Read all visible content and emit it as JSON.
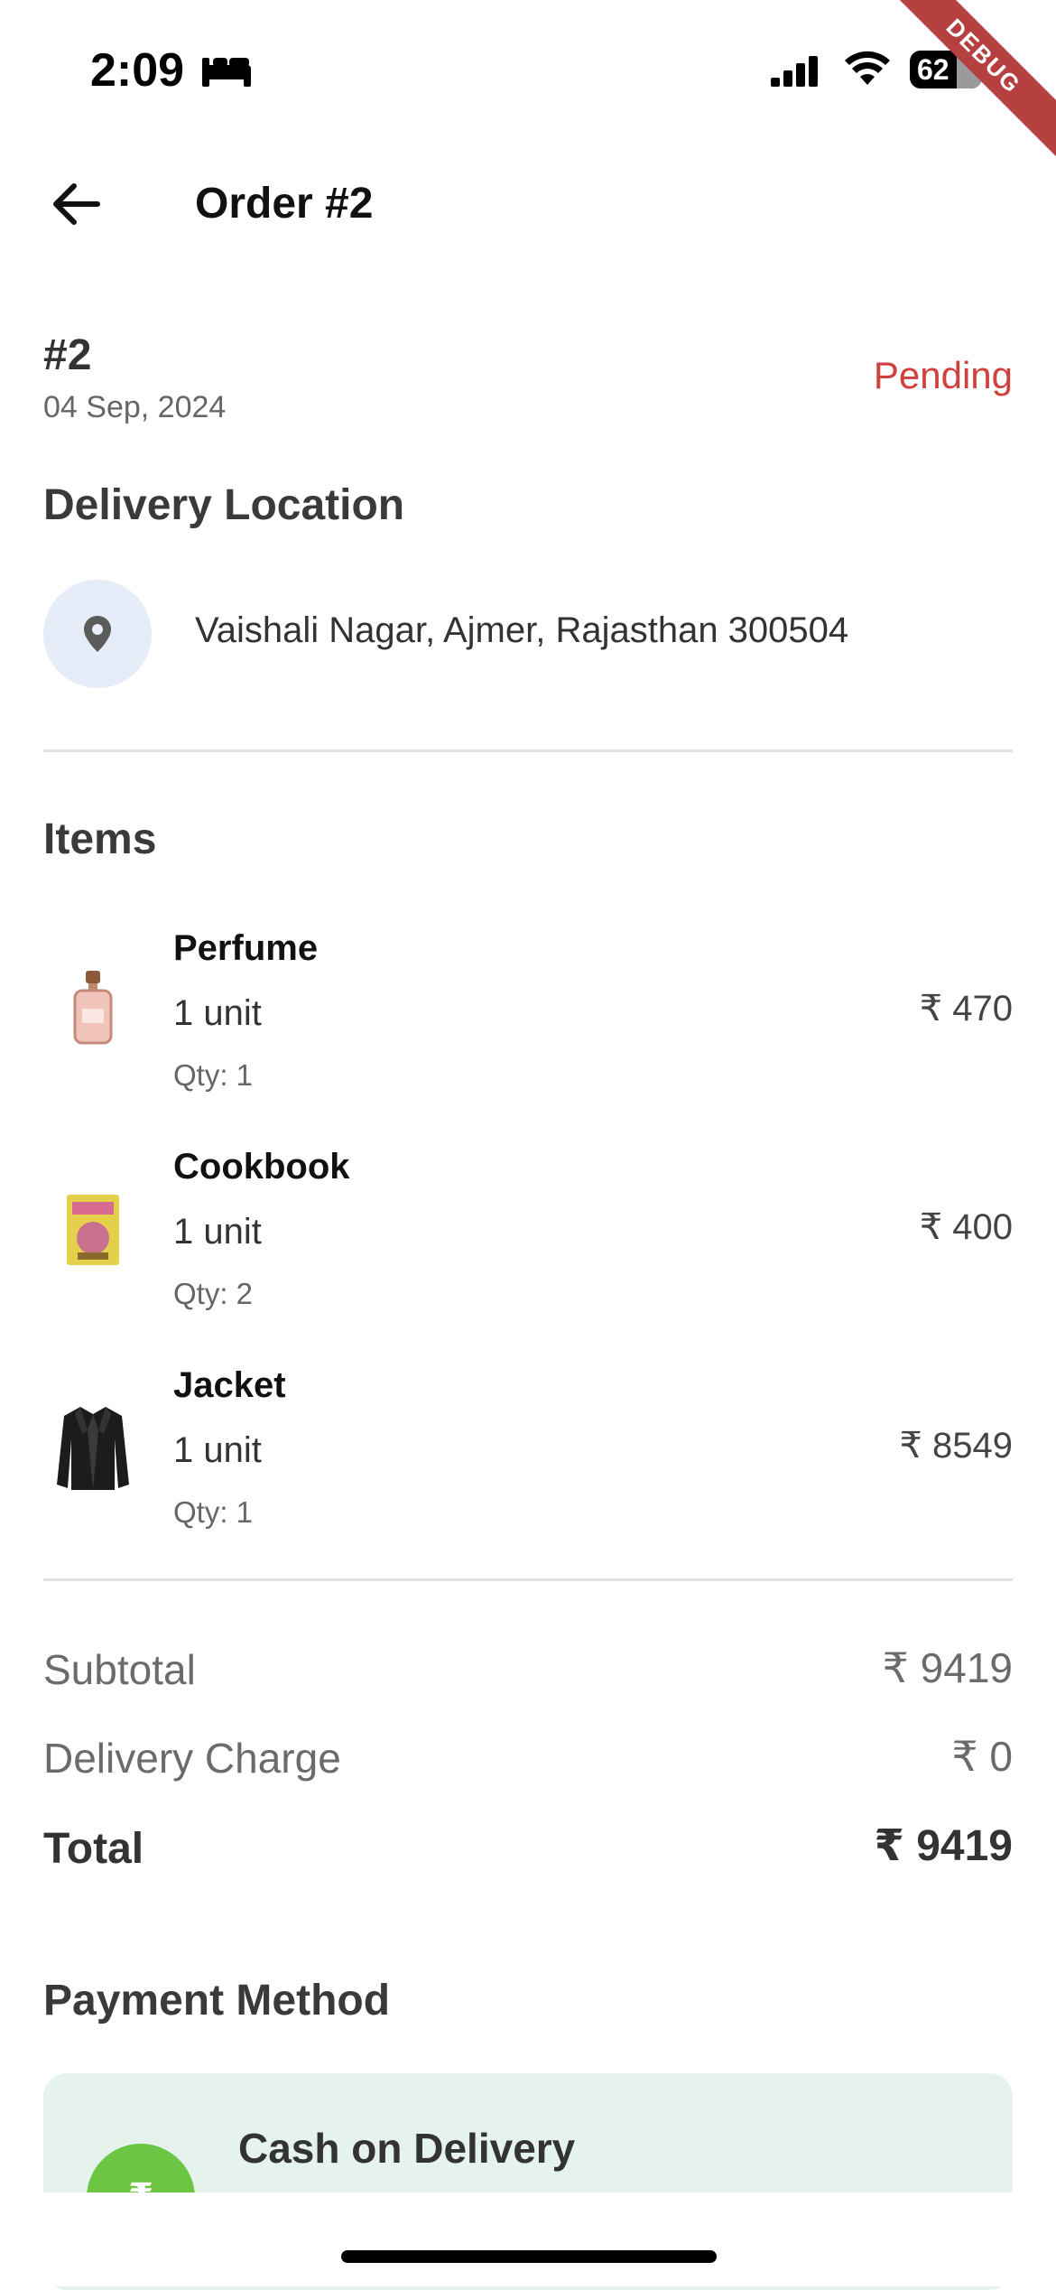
{
  "status_bar": {
    "time": "2:09",
    "battery": "62"
  },
  "debug_label": "DEBUG",
  "header": {
    "title": "Order #2"
  },
  "order": {
    "number": "#2",
    "date": "04 Sep, 2024",
    "status": "Pending",
    "status_color": "#d0413d"
  },
  "delivery": {
    "title": "Delivery Location",
    "address": "Vaishali Nagar, Ajmer, Rajasthan 300504"
  },
  "items_section": {
    "title": "Items",
    "items": [
      {
        "name": "Perfume",
        "unit": "1 unit",
        "qty": "Qty: 1",
        "price": "₹ 470",
        "icon": "perfume-image"
      },
      {
        "name": "Cookbook",
        "unit": "1 unit",
        "qty": "Qty: 2",
        "price": "₹ 400",
        "icon": "book-image"
      },
      {
        "name": "Jacket",
        "unit": "1 unit",
        "qty": "Qty: 1",
        "price": "₹ 8549",
        "icon": "jacket-image"
      }
    ]
  },
  "summary": {
    "subtotal_label": "Subtotal",
    "subtotal_value": "₹ 9419",
    "delivery_label": "Delivery Charge",
    "delivery_value": "₹ 0",
    "total_label": "Total",
    "total_value": "₹ 9419"
  },
  "payment": {
    "title": "Payment Method",
    "method": "Cash on Delivery",
    "symbol": "₹",
    "accent": "#6cc644"
  }
}
